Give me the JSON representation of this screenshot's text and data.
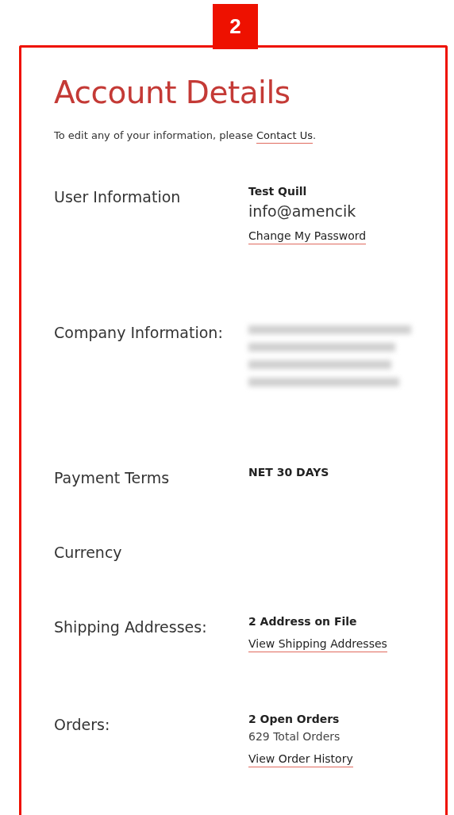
{
  "annotation": {
    "label": "2"
  },
  "title": "Account Details",
  "intro": {
    "text": "To edit any of your information, please ",
    "link": "Contact Us",
    "after": "."
  },
  "rows": [
    {
      "label": "User Information",
      "values": [
        {
          "kind": "bold",
          "text": "Test Quill"
        },
        {
          "kind": "large",
          "text": "info@amencik"
        },
        {
          "kind": "link",
          "text": "Change My Password"
        }
      ]
    },
    {
      "label": "Company Information:",
      "values": [
        {
          "kind": "redacted"
        }
      ]
    },
    {
      "label": "Payment Terms",
      "values": [
        {
          "kind": "bold",
          "text": "NET 30 DAYS"
        }
      ]
    },
    {
      "label": "Currency",
      "values": []
    },
    {
      "label": "Shipping Addresses:",
      "values": [
        {
          "kind": "bold",
          "text": "2 Address on File"
        },
        {
          "kind": "link",
          "text": "View Shipping Addresses"
        }
      ]
    },
    {
      "label": "Orders:",
      "values": [
        {
          "kind": "bold",
          "text": "2 Open Orders"
        },
        {
          "kind": "small",
          "text": "629 Total Orders"
        },
        {
          "kind": "link",
          "text": "View Order History"
        }
      ]
    }
  ]
}
